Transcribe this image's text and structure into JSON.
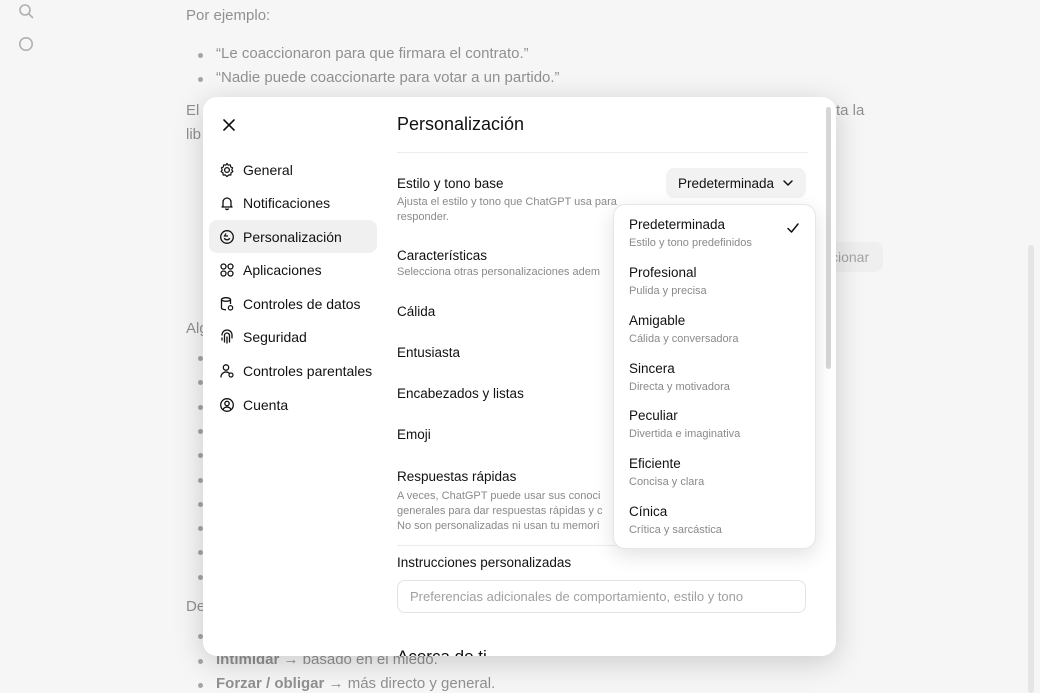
{
  "background": {
    "intro": "Por ejemplo:",
    "examples": [
      "“Le coaccionaron para que firmara el contrato.”",
      "“Nadie puede coaccionarte para votar a un partido.”"
    ],
    "para_start": "El",
    "para_end": "ta la",
    "para2_start": "lib",
    "action_pill": "ccionar",
    "alg_prefix": "Alg",
    "de_prefix": "De",
    "bottom_items": [
      {
        "bold": "Intimidar",
        "rest": " → basado en el miedo."
      },
      {
        "bold": "Forzar / obligar",
        "rest": " → más directo y general."
      }
    ]
  },
  "modal": {
    "title": "Personalización",
    "nav": [
      {
        "label": "General",
        "icon": "gear-icon"
      },
      {
        "label": "Notificaciones",
        "icon": "bell-icon"
      },
      {
        "label": "Personalización",
        "icon": "personalization-icon",
        "active": true
      },
      {
        "label": "Aplicaciones",
        "icon": "apps-grid-icon"
      },
      {
        "label": "Controles de datos",
        "icon": "database-icon"
      },
      {
        "label": "Seguridad",
        "icon": "fingerprint-shield-icon"
      },
      {
        "label": "Controles parentales",
        "icon": "parent-user-icon"
      },
      {
        "label": "Cuenta",
        "icon": "account-circle-icon"
      }
    ],
    "base_style": {
      "title": "Estilo y tono base",
      "desc": "Ajusta el estilo y tono que ChatGPT usa para responder.",
      "selected": "Predeterminada"
    },
    "characteristics": {
      "title": "Características",
      "desc": "Selecciona otras personalizaciones adem"
    },
    "traits": [
      "Cálida",
      "Entusiasta",
      "Encabezados y listas",
      "Emoji"
    ],
    "quick_answers": {
      "title": "Respuestas rápidas",
      "lines": [
        "A veces, ChatGPT puede usar sus conoci",
        "generales para dar respuestas rápidas y c",
        "No son personalizadas ni usan tu memori"
      ]
    },
    "custom_instructions": {
      "title": "Instrucciones personalizadas",
      "placeholder": "Preferencias adicionales de comportamiento, estilo y tono"
    },
    "cut_heading": "Acerca de ti"
  },
  "dropdown": {
    "options": [
      {
        "name": "Predeterminada",
        "desc": "Estilo y tono predefinidos",
        "selected": true
      },
      {
        "name": "Profesional",
        "desc": "Pulida y precisa"
      },
      {
        "name": "Amigable",
        "desc": "Cálida y conversadora"
      },
      {
        "name": "Sincera",
        "desc": "Directa y motivadora"
      },
      {
        "name": "Peculiar",
        "desc": "Divertida e imaginativa"
      },
      {
        "name": "Eficiente",
        "desc": "Concisa y clara"
      },
      {
        "name": "Cínica",
        "desc": "Crítica y sarcástica"
      }
    ]
  },
  "colors": {
    "modal_bg": "#ffffff",
    "active_nav": "#f0f0f0",
    "muted_text": "#8a8a8a"
  }
}
